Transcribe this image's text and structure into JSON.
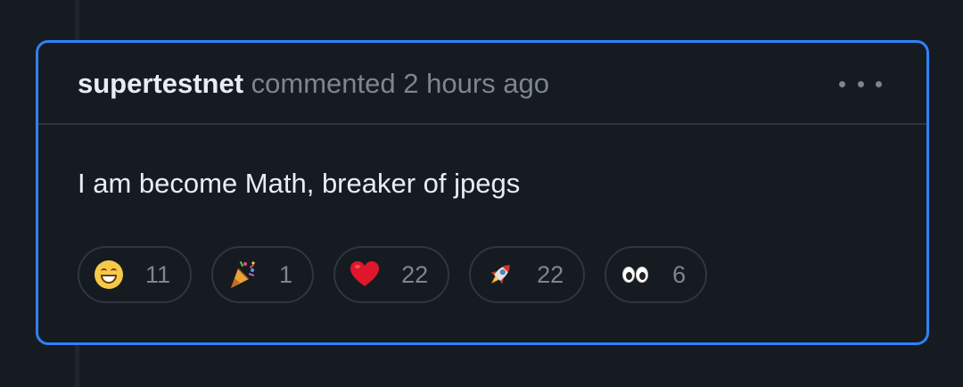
{
  "comment": {
    "author": "supertestnet",
    "action": "commented",
    "timestamp": "2 hours ago",
    "body": "I am become Math, breaker of jpegs",
    "more_icon": "kebab-horizontal-icon"
  },
  "reactions": [
    {
      "icon": "smile-emoji",
      "count": "11"
    },
    {
      "icon": "tada-emoji",
      "count": "1"
    },
    {
      "icon": "heart-emoji",
      "count": "22"
    },
    {
      "icon": "rocket-emoji",
      "count": "22"
    },
    {
      "icon": "eyes-emoji",
      "count": "6"
    }
  ],
  "colors": {
    "background": "#161b22",
    "card_border_focus": "#2f81f7",
    "divider": "#30363d",
    "text_primary": "#e6edf3",
    "text_muted": "#7d8590"
  }
}
